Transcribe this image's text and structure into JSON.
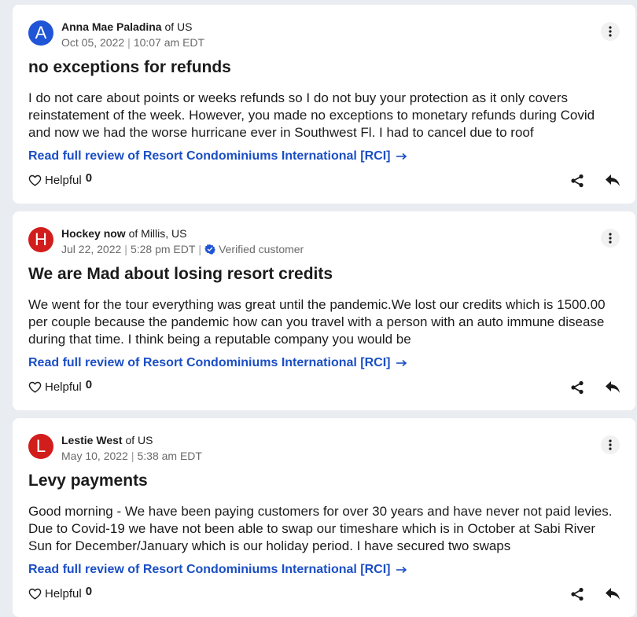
{
  "reviews": [
    {
      "avatar_letter": "A",
      "avatar_color": "#1f55d6",
      "name": "Anna Mae Paladina",
      "location": "of US",
      "date": "Oct 05, 2022",
      "time": "10:07 am EDT",
      "verified_label": "",
      "title": "no exceptions for refunds",
      "body": "I do not care about points or weeks refunds so I do not buy your protection as it only covers reinstatement of the week. However, you made no exceptions to monetary refunds during Covid and now we had the worse hurricane ever in Southwest Fl. I had to cancel due to roof",
      "link_text": "Read full review of Resort Condominiums International [RCI]",
      "helpful_label": "Helpful",
      "helpful_count": "0"
    },
    {
      "avatar_letter": "H",
      "avatar_color": "#d21d1d",
      "name": "Hockey now",
      "location": "of Millis, US",
      "date": "Jul 22, 2022",
      "time": "5:28 pm EDT",
      "verified_label": "Verified customer",
      "title": "We are Mad about losing resort credits",
      "body": "We went for the tour everything was great until the pandemic.We lost our credits which is 1500.00 per couple because the pandemic how can you travel with a person with an auto immune disease during that time. I think being a reputable company you would be",
      "link_text": "Read full review of Resort Condominiums International [RCI]",
      "helpful_label": "Helpful",
      "helpful_count": "0"
    },
    {
      "avatar_letter": "L",
      "avatar_color": "#d21d1d",
      "name": "Lestie West",
      "location": "of US",
      "date": "May 10, 2022",
      "time": "5:38 am EDT",
      "verified_label": "",
      "title": "Levy payments",
      "body": "Good morning - We have been paying customers for over 30 years and have never not paid levies. Due to Covid-19 we have not been able to swap our timeshare which is in October at Sabi River Sun for December/January which is our holiday period. I have secured two swaps",
      "link_text": "Read full review of Resort Condominiums International [RCI]",
      "helpful_label": "Helpful",
      "helpful_count": "0"
    }
  ],
  "icons": {
    "more": "more-vertical-icon",
    "verified": "verified-check-icon",
    "link_arrow": "arrow-right-icon",
    "heart": "heart-outline-icon",
    "share": "share-icon",
    "reply": "reply-icon"
  },
  "colors": {
    "page_background": "#e9ecf0",
    "card_background": "#ffffff",
    "link": "#1a4ec5",
    "verified": "#1f55d6",
    "meta_text": "#696a6a"
  }
}
